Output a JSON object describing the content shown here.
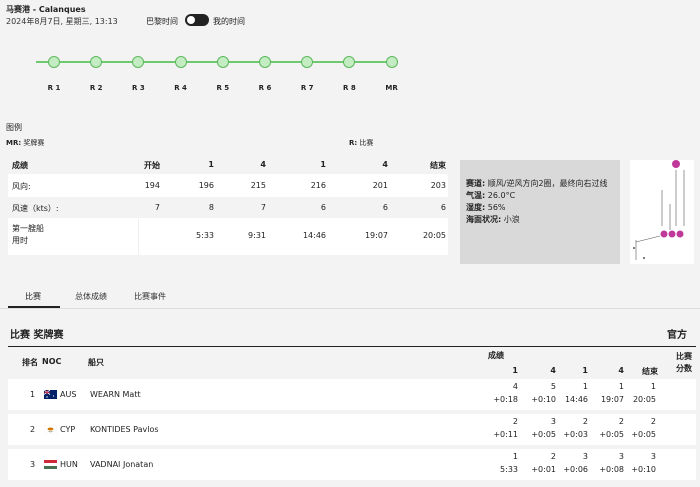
{
  "header": {
    "venue": "马赛港 - Calanques",
    "datetime": "2024年8月7日, 星期三, 13:13",
    "tz_paris": "巴黎时间",
    "tz_mine": "我的时间"
  },
  "race_nodes": [
    "R1",
    "R2",
    "R3",
    "R4",
    "R5",
    "R6",
    "R7",
    "R8",
    "MR"
  ],
  "legend": {
    "title": "图例",
    "mr_key": "MR:",
    "mr_value": "奖牌赛",
    "r_key": "R:",
    "r_value": "比赛"
  },
  "weather": {
    "columns": [
      "成绩",
      "开始",
      "1",
      "4",
      "1",
      "4",
      "结束"
    ],
    "rows": [
      {
        "label": "风向:",
        "values": [
          "194",
          "196",
          "215",
          "216",
          "201",
          "203"
        ]
      },
      {
        "label": "风速（kts）:",
        "values": [
          "7",
          "8",
          "7",
          "6",
          "6",
          "6"
        ]
      },
      {
        "label_line1": "第一艘船",
        "label_line2": "用时",
        "values": [
          "",
          "5:33",
          "9:31",
          "14:46",
          "19:07",
          "20:05"
        ]
      }
    ]
  },
  "conditions": {
    "course_key": "赛道:",
    "course_value": "顺风/逆风方向2圈，最终向右过线",
    "temp_key": "气温:",
    "temp_value": "26.0°C",
    "humidity_key": "湿度:",
    "humidity_value": "56%",
    "sea_key": "海面状况:",
    "sea_value": "小浪"
  },
  "tabs": [
    "比赛",
    "总体成绩",
    "比赛事件"
  ],
  "results": {
    "title": "比赛 奖牌赛",
    "official": "官方",
    "headers": {
      "rank": "排名",
      "noc": "NOC",
      "boat": "船只",
      "score": "成绩",
      "marks": [
        "1",
        "4",
        "1",
        "4",
        "结束"
      ],
      "points_line1": "比赛",
      "points_line2": "分数"
    },
    "rows": [
      {
        "rank": "1",
        "noc": "AUS",
        "name": "WEARN Matt",
        "marks": [
          [
            "4",
            "+0:18"
          ],
          [
            "5",
            "+0:10"
          ],
          [
            "1",
            "14:46"
          ],
          [
            "1",
            "19:07"
          ],
          [
            "1",
            "20:05"
          ]
        ],
        "points": "2"
      },
      {
        "rank": "2",
        "noc": "CYP",
        "name": "KONTIDES Pavlos",
        "marks": [
          [
            "2",
            "+0:11"
          ],
          [
            "3",
            "+0:05"
          ],
          [
            "2",
            "+0:03"
          ],
          [
            "2",
            "+0:05"
          ],
          [
            "2",
            "+0:05"
          ]
        ],
        "points": "4"
      },
      {
        "rank": "3",
        "noc": "HUN",
        "name": "VADNAI Jonatan",
        "marks": [
          [
            "1",
            "5:33"
          ],
          [
            "2",
            "+0:01"
          ],
          [
            "3",
            "+0:06"
          ],
          [
            "3",
            "+0:08"
          ],
          [
            "3",
            "+0:10"
          ]
        ],
        "points": "6"
      }
    ]
  },
  "colors": {
    "race_line": "#6ec86e",
    "race_node": "#c3ecc3",
    "conditions_bg": "#d9d9d9",
    "map_accent": "#c0399a"
  }
}
